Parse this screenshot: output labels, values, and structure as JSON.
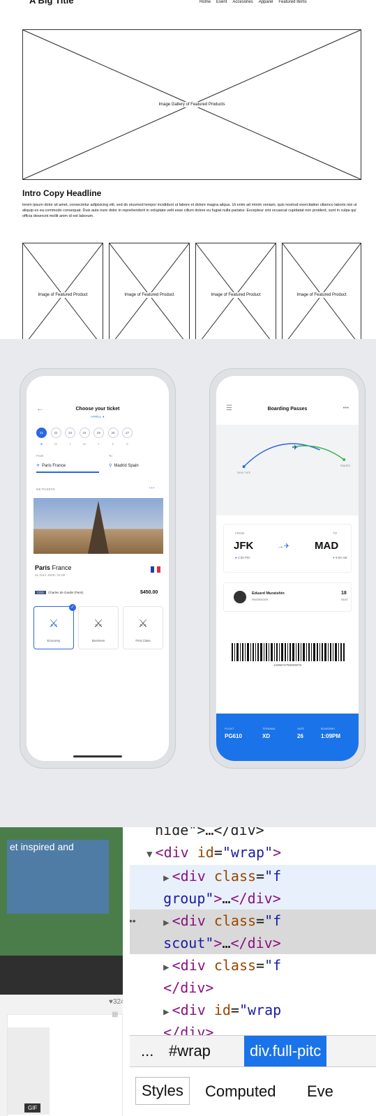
{
  "wireframe": {
    "title": "A Big Title",
    "nav": [
      "Home",
      "Event",
      "Accesories",
      "Apparel",
      "Featured Items"
    ],
    "gallery_caption": "Image Gallery of Featured Products",
    "intro_headline": "Intro Copy Headline",
    "intro_body": "lorem ipsum dolor sit amet, consectetur adipisicing elit, sed do eiusmod tempor incididunt ut labore et dolore magna aliqua. Ut enim ad minim veniam, quis nostrud exercitation ullamco laboris nisi ut aliquip ex ea commodo consequat. Duis aute irure dolor in reprehenderit in voluptate velit esse cillum dolore eu fugiat nulla pariatur. Excepteur sint occaecat cupidatat non proident, sunt in culpa qui officia deserunt mollit anim id est laborum.",
    "product_captions": [
      "Image of Featured Product",
      "Image of Featured Product",
      "Image of Featured Product",
      "Image of Featured Product"
    ]
  },
  "ticket_app": {
    "title": "Choose your ticket",
    "month": "APRIL ▾",
    "days": [
      "21",
      "22",
      "23",
      "24",
      "25",
      "26",
      "27"
    ],
    "weekdays": [
      "S",
      "M",
      "T",
      "W",
      "T",
      "F",
      "S"
    ],
    "from_label": "From",
    "to_label": "To",
    "from_city": "Paris France",
    "to_city": "Madrid Spain",
    "tickets_count": "5/6 TICKETS",
    "city_bold": "Paris",
    "city_rest": " France",
    "date_text": "21 JULY 2018 / 21:00",
    "airport_code": "CDG",
    "airport_name": "Charles de Gaulle (Paris)",
    "price": "$450.00",
    "classes": [
      "Economy",
      "Business",
      "First Class"
    ],
    "accent": "#2a67e0"
  },
  "boarding": {
    "title": "Boarding Passes",
    "map_from": "New York",
    "map_to": "Madrid",
    "from_label": "FROM",
    "to_label": "TO",
    "from_code": "JFK",
    "to_code": "MAD",
    "from_time": "2:00 PM",
    "to_time": "9:00 AM",
    "passenger_name": "Eduard Muratshin",
    "passenger_label": "PASSENGER",
    "seat": "18",
    "seat_label": "SEAT",
    "barcode_number": "1235674758393975",
    "footer": [
      {
        "k": "FLIGHT",
        "v": "PG610"
      },
      {
        "k": "TERMINAL",
        "v": "XD"
      },
      {
        "k": "GATE",
        "v": "26"
      },
      {
        "k": "BOARDING",
        "v": "1:09PM"
      }
    ],
    "accent": "#1a73e8"
  },
  "devtools": {
    "page_text": "et inspired and",
    "likes": "324",
    "gif_label": "GIF",
    "crumb_dots": "...",
    "crumb_wrap": "#wrap",
    "crumb_selected": "div.full-pitc",
    "tabs": [
      "Styles",
      "Computed",
      "Eve"
    ]
  }
}
